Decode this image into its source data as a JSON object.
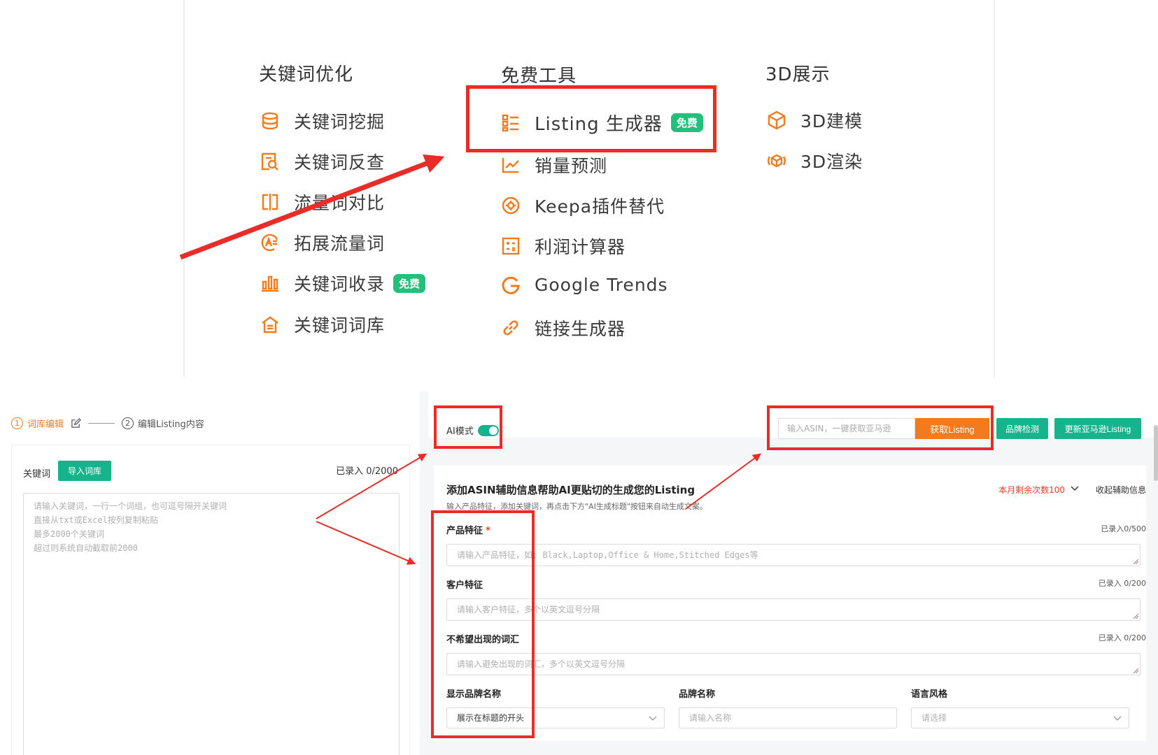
{
  "menu": {
    "columns": [
      {
        "title": "关键词优化",
        "items": [
          {
            "label": "关键词挖掘",
            "icon": "database-icon"
          },
          {
            "label": "关键词反查",
            "icon": "reverse-search-icon"
          },
          {
            "label": "流量词对比",
            "icon": "compare-icon"
          },
          {
            "label": "拓展流量词",
            "icon": "expand-keyword-icon"
          },
          {
            "label": "关键词收录",
            "icon": "bar-chart-icon",
            "tag": "免费"
          },
          {
            "label": "关键词词库",
            "icon": "library-home-icon"
          }
        ]
      },
      {
        "title": "免费工具",
        "items": [
          {
            "label": "Listing 生成器",
            "icon": "list-icon",
            "tag": "免费"
          },
          {
            "label": "销量预测",
            "icon": "sales-trend-icon"
          },
          {
            "label": "Keepa插件替代",
            "icon": "plugin-icon"
          },
          {
            "label": "利润计算器",
            "icon": "calculator-icon"
          },
          {
            "label": "Google Trends",
            "icon": "google-g-icon"
          },
          {
            "label": "链接生成器",
            "icon": "link-icon"
          }
        ]
      },
      {
        "title": "3D展示",
        "items": [
          {
            "label": "3D建模",
            "icon": "cube-icon"
          },
          {
            "label": "3D渲染",
            "icon": "render-cube-icon"
          }
        ]
      }
    ]
  },
  "steps": {
    "step1_num": "1",
    "step1_label": "词库编辑",
    "step2_num": "2",
    "step2_label": "编辑Listing内容"
  },
  "keywords": {
    "label": "关键词",
    "import_button": "导入词库",
    "count": "已录入 0/2000",
    "placeholder": "请输入关键词，一行一个词组，也可逗号隔开关键词\n直接从txt或Excel按列复制粘贴\n最多2000个关键词\n超过则系统自动截取前2000"
  },
  "header": {
    "ai_mode_label": "AI模式",
    "ai_mode_on": true,
    "asin_placeholder": "输入ASIN，一键获取亚马逊",
    "get_listing_button": "获取Listing",
    "brand_check_button": "品牌检测",
    "update_listing_button": "更新亚马逊Listing"
  },
  "form": {
    "title": "添加ASIN辅助信息帮助AI更贴切的生成您的Listing",
    "subtitle": "输入产品特征，添加关键词，再点击下方\"AI生成标题\"按钮来自动生成文案。",
    "remaining": "本月剩余次数100",
    "collapse_label": "收起辅助信息",
    "product_feature": {
      "label": "产品特征",
      "required_mark": "*",
      "count": "已录入0/500",
      "placeholder": "请输入产品特征，如: Black,Laptop,Office & Home,Stitched Edges等"
    },
    "customer_feature": {
      "label": "客户特征",
      "count": "已录入 0/200",
      "placeholder": "请输入客户特征，多个以英文逗号分隔"
    },
    "avoid_words": {
      "label": "不希望出现的词汇",
      "count": "已录入 0/200",
      "placeholder": "请输入避免出现的词汇，多个以英文逗号分隔"
    },
    "brand_display": {
      "label": "显示品牌名称",
      "value": "展示在标题的开头"
    },
    "brand_name": {
      "label": "品牌名称",
      "placeholder": "请输入名称"
    },
    "language_style": {
      "label": "语言风格",
      "placeholder": "请选择"
    }
  },
  "colors": {
    "green": "#16b48c",
    "orange": "#f37b1d",
    "annotation_red": "#ea2b26",
    "free_tag": "#22c07a"
  }
}
